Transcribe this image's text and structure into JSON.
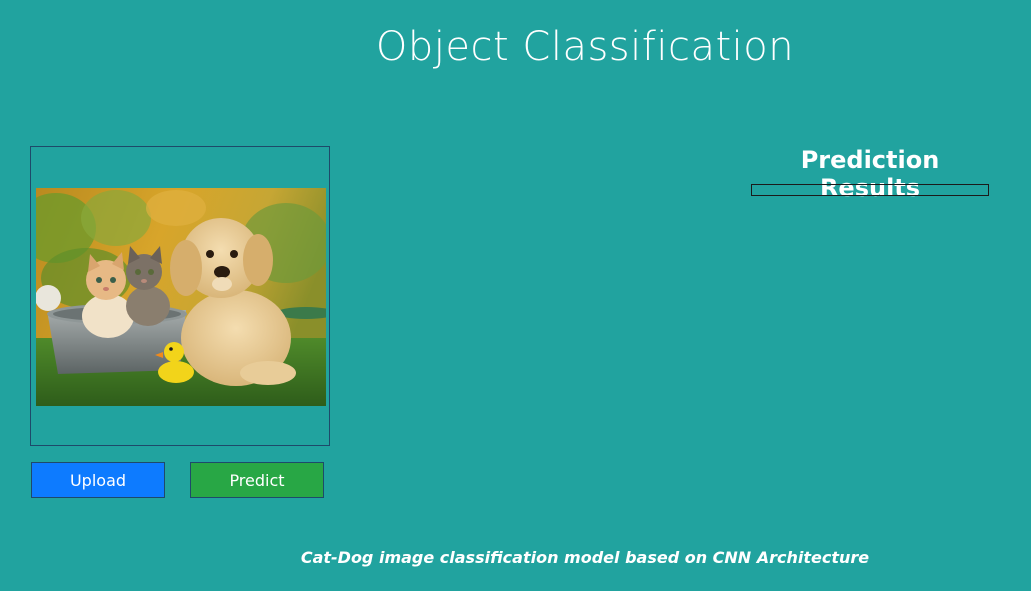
{
  "header": {
    "title": "Object Classification"
  },
  "preview": {
    "image_subject": "puppy and two kittens in a metal tub on grass with a yellow rubber duck"
  },
  "buttons": {
    "upload_label": "Upload",
    "predict_label": "Predict"
  },
  "results": {
    "heading": "Prediction Results",
    "value": ""
  },
  "footer": {
    "caption": "Cat-Dog image classification model based on CNN Architecture"
  },
  "colors": {
    "background": "#21a39f",
    "upload_button": "#0d7bff",
    "predict_button": "#28a745",
    "text": "#ffffff"
  }
}
